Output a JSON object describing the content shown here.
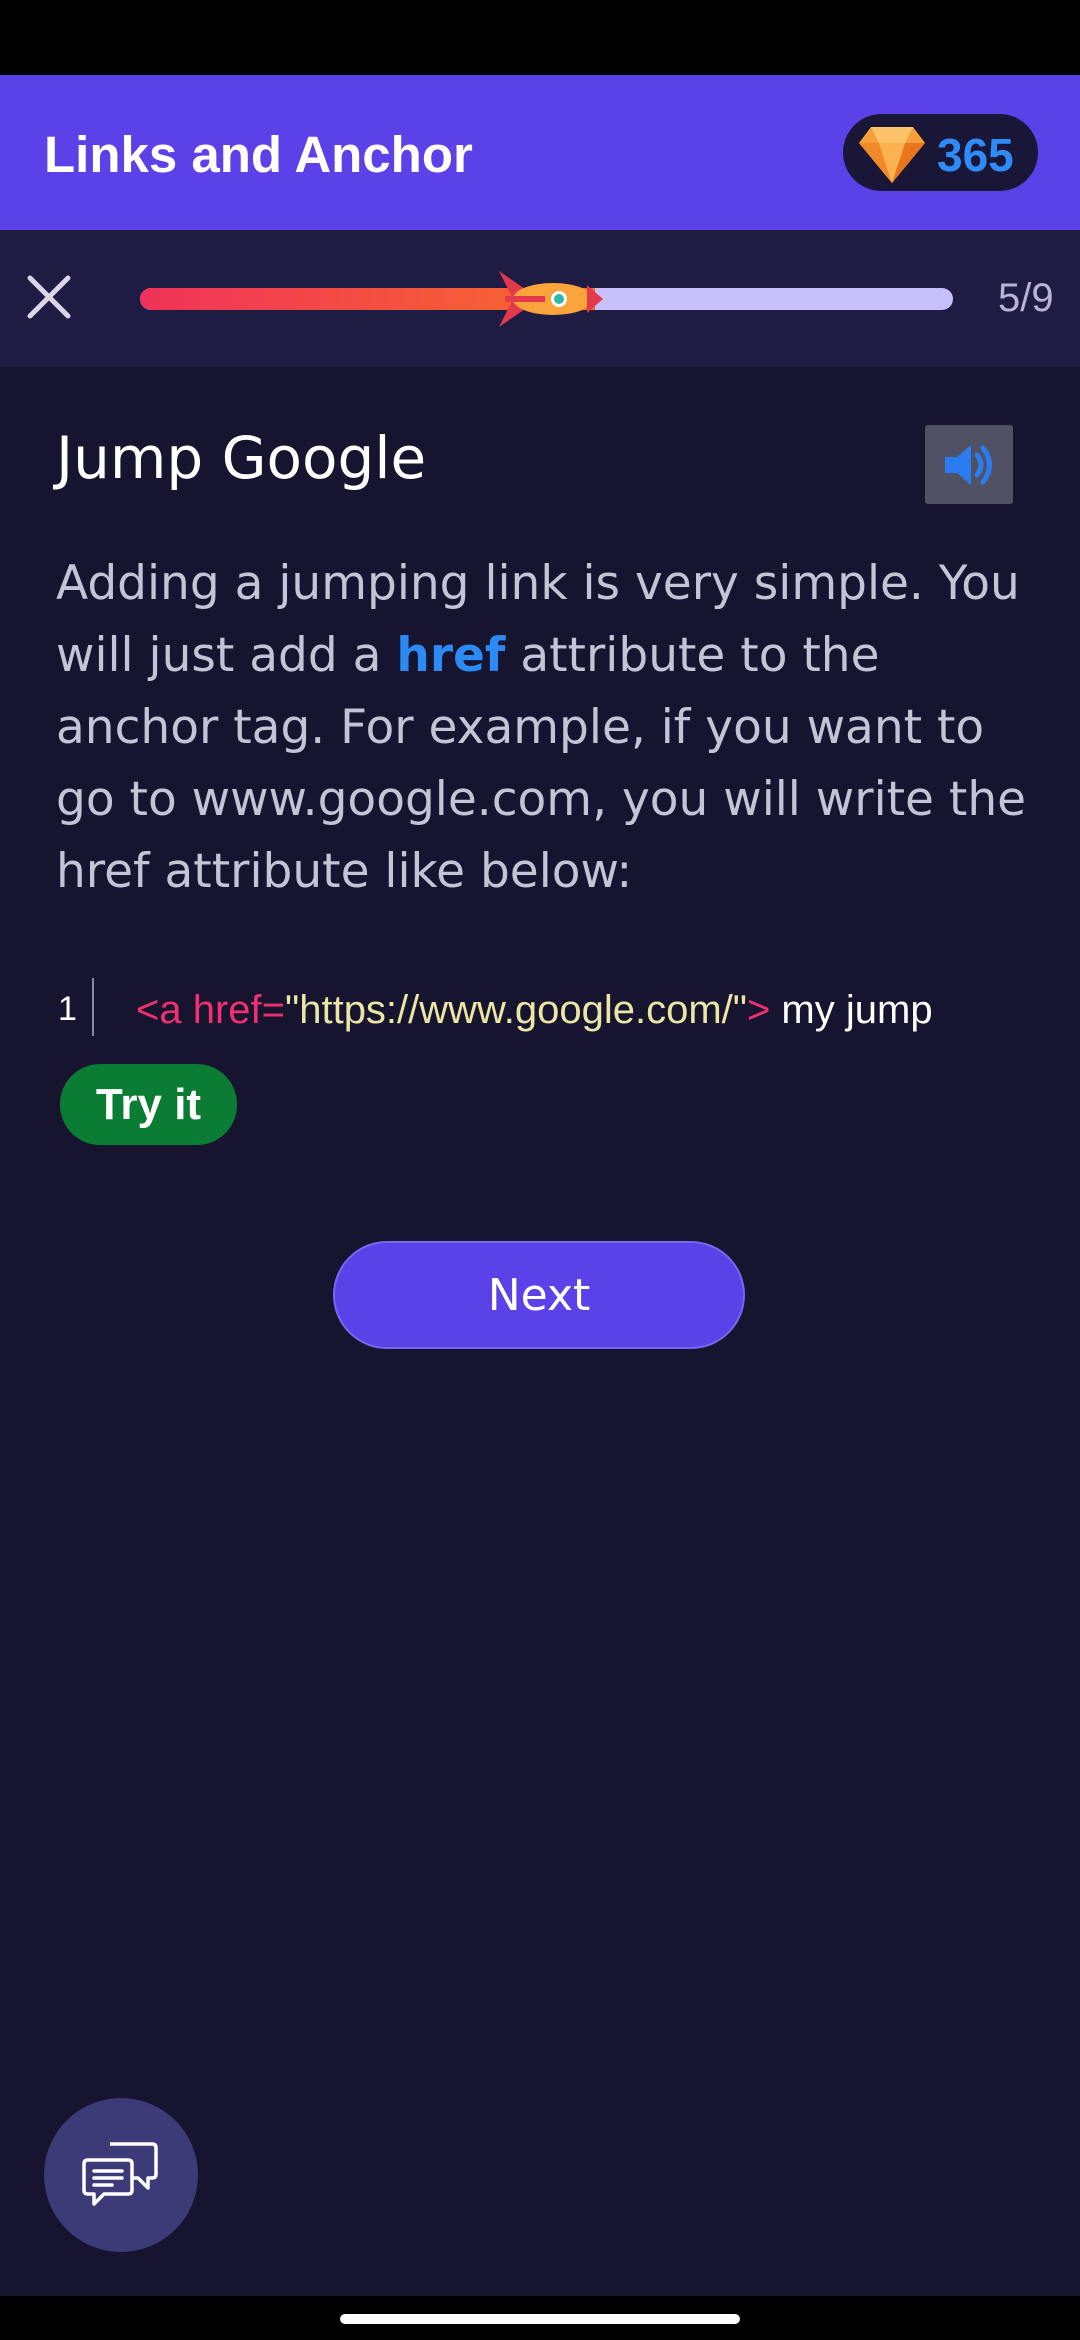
{
  "header": {
    "title": "Links and Anchor",
    "gem_count": "365",
    "gem_icon": "diamond-icon"
  },
  "progress": {
    "current": 5,
    "total": 9,
    "label": "5/9",
    "fraction": 0.56
  },
  "lesson": {
    "title": "Jump Google",
    "body_part1": "Adding a jumping link is very simple. You will just add a ",
    "body_highlight": "href",
    "body_part2": " attribute to the anchor tag. For example, if you want to go to www.google.com, you will write the href attribute like below:"
  },
  "code": {
    "line_number": "1",
    "tag_open": "<a href=",
    "string": "\"https://www.google.com/\"",
    "tag_close": ">",
    "text": " my jump"
  },
  "buttons": {
    "try_it": "Try it",
    "next": "Next"
  },
  "colors": {
    "accent": "#5b41e8",
    "background": "#16142f",
    "try_green": "#0a7c33",
    "highlight_blue": "#2b8af4"
  }
}
